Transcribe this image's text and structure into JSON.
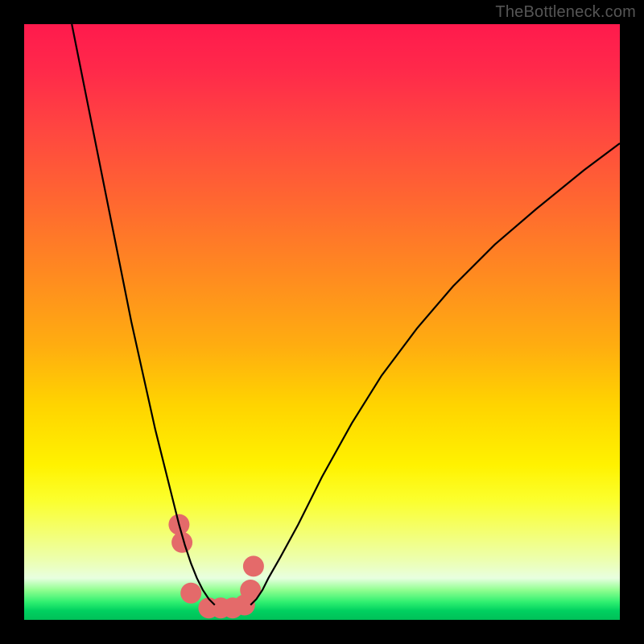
{
  "watermark": "TheBottleneck.com",
  "chart_data": {
    "type": "line",
    "title": "",
    "xlabel": "",
    "ylabel": "",
    "xlim": [
      0,
      100
    ],
    "ylim": [
      0,
      100
    ],
    "series": [
      {
        "name": "left-branch",
        "x": [
          8,
          10,
          12,
          14,
          16,
          18,
          20,
          22,
          24,
          25,
          26,
          27,
          28,
          29,
          30,
          31,
          32
        ],
        "y": [
          100,
          90,
          80,
          70,
          60,
          50,
          41,
          32,
          24,
          20,
          16,
          12.5,
          9.5,
          7,
          5,
          3.5,
          2.5
        ]
      },
      {
        "name": "right-branch",
        "x": [
          38,
          39,
          40,
          41,
          43,
          46,
          50,
          55,
          60,
          66,
          72,
          79,
          86,
          94,
          100
        ],
        "y": [
          2.5,
          3.5,
          5,
          7,
          10.5,
          16,
          24,
          33,
          41,
          49,
          56,
          63,
          69,
          75.5,
          80
        ]
      },
      {
        "name": "valley-markers",
        "x": [
          26,
          26.5,
          28,
          31,
          33,
          35,
          37,
          38,
          38.5
        ],
        "y": [
          16,
          13,
          4.5,
          2,
          2,
          2,
          2.5,
          5,
          9
        ]
      }
    ],
    "valley_x_range": [
      27,
      38
    ],
    "colors": {
      "curve": "#000000",
      "markers": "#e46a6a",
      "gradient_top": "#ff1a4d",
      "gradient_mid": "#ffe000",
      "gradient_bottom": "#00c058"
    }
  }
}
